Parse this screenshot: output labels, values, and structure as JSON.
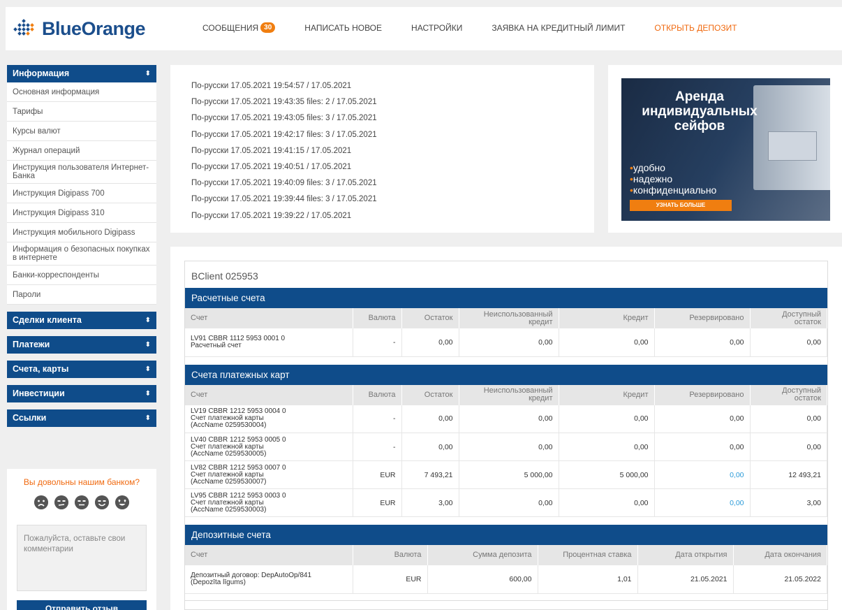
{
  "logo": {
    "text": "BlueOrange"
  },
  "nav": {
    "messages": "СООБЩЕНИЯ",
    "messages_count": "30",
    "write_new": "НАПИСАТЬ НОВОЕ",
    "settings": "НАСТРОЙКИ",
    "credit_limit": "ЗАЯВКА НА КРЕДИТНЫЙ ЛИМИТ",
    "open_deposit": "ОТКРЫТЬ ДЕПОЗИТ"
  },
  "sidebar": {
    "info_header": "Информация",
    "info_items": [
      "Основная информация",
      "Тарифы",
      "Курсы валют",
      "Журнал операций",
      "Инструкция пользователя Интернет-Банка",
      "Инструкция Digipass 700",
      "Инструкция Digipass 310",
      "Инструкция мобильного Digipass",
      "Информация о безопасных покупках в интернете",
      "Банки-корреспонденты",
      "Пароли"
    ],
    "sections": [
      "Сделки клиента",
      "Платежи",
      "Счета, карты",
      "Инвестиции",
      "Ссылки"
    ]
  },
  "feedback": {
    "question": "Вы довольны нашим банком?",
    "placeholder": "Пожалуйста, оставьте свои комментарии",
    "submit": "Отправить отзыв"
  },
  "messages": [
    "По-русски 17.05.2021 19:54:57 / 17.05.2021",
    "По-русски 17.05.2021 19:43:35 files: 2 / 17.05.2021",
    "По-русски 17.05.2021 19:43:05 files: 3 / 17.05.2021",
    "По-русски 17.05.2021 19:42:17 files: 3 / 17.05.2021",
    "По-русски 17.05.2021 19:41:15 / 17.05.2021",
    "По-русски 17.05.2021 19:40:51 / 17.05.2021",
    "По-русски 17.05.2021 19:40:09 files: 3 / 17.05.2021",
    "По-русски 17.05.2021 19:39:44 files: 3 / 17.05.2021",
    "По-русски 17.05.2021 19:39:22 / 17.05.2021"
  ],
  "banner": {
    "title_lines": [
      "Аренда",
      "индивидуальных",
      "сейфов"
    ],
    "bullets": [
      "удобно",
      "надежно",
      "конфиденциально"
    ],
    "button": "УЗНАТЬ БОЛЬШЕ"
  },
  "client": "BClient 025953",
  "current_accounts": {
    "title": "Расчетные счета",
    "headers": [
      "Счет",
      "Валюта",
      "Остаток",
      "Неиспользованный кредит",
      "Кредит",
      "Резервировано",
      "Доступный остаток"
    ],
    "rows": [
      {
        "acc": "LV91 CBBR 1112 5953 0001 0",
        "name": "Расчетный счет",
        "note": "",
        "cur": "-",
        "bal": "0,00",
        "unused": "0,00",
        "credit": "0,00",
        "reserved": "0,00",
        "avail": "0,00"
      }
    ]
  },
  "card_accounts": {
    "title": "Счета платежных карт",
    "headers": [
      "Счет",
      "Валюта",
      "Остаток",
      "Неиспользованный кредит",
      "Кредит",
      "Резервировано",
      "Доступный остаток"
    ],
    "rows": [
      {
        "acc": "LV19 CBBR 1212 5953 0004 0",
        "name": "Счет платежной карты",
        "note": "(AccName 0259530004)",
        "cur": "-",
        "bal": "0,00",
        "unused": "0,00",
        "credit": "0,00",
        "reserved": "0,00",
        "avail": "0,00"
      },
      {
        "acc": "LV40 CBBR 1212 5953 0005 0",
        "name": "Счет платежной карты",
        "note": "(AccName 0259530005)",
        "cur": "-",
        "bal": "0,00",
        "unused": "0,00",
        "credit": "0,00",
        "reserved": "0,00",
        "avail": "0,00"
      },
      {
        "acc": "LV82 CBBR 1212 5953 0007 0",
        "name": "Счет платежной карты",
        "note": "(AccName 0259530007)",
        "cur": "EUR",
        "bal": "7 493,21",
        "unused": "5 000,00",
        "credit": "5 000,00",
        "reserved": "0,00",
        "avail": "12 493,21"
      },
      {
        "acc": "LV95 CBBR 1212 5953 0003 0",
        "name": "Счет платежной карты",
        "note": "(AccName 0259530003)",
        "cur": "EUR",
        "bal": "3,00",
        "unused": "0,00",
        "credit": "0,00",
        "reserved": "0,00",
        "avail": "3,00"
      }
    ]
  },
  "deposits": {
    "title": "Депозитные счета",
    "headers": [
      "Счет",
      "Валюта",
      "Сумма депозита",
      "Процентная ставка",
      "Дата открытия",
      "Дата окончания"
    ],
    "rows": [
      {
        "acc": "Депозитный договор: DepAutoOp/841",
        "name": "(Depozīta līgums)",
        "cur": "EUR",
        "amount": "600,00",
        "rate": "1,01",
        "opened": "21.05.2021",
        "ends": "21.05.2022"
      }
    ]
  },
  "colors": {
    "brand_blue": "#0f4c8a",
    "accent_orange": "#f07e10",
    "link_blue": "#2a9ad8"
  }
}
